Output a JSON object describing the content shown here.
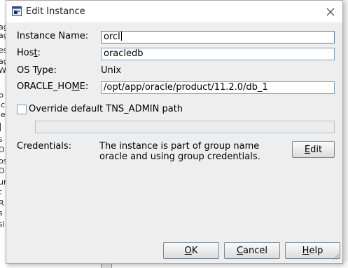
{
  "window": {
    "title": "Edit Instance",
    "icon": "app-window-icon"
  },
  "background_strip": {
    "fragments": [
      "ag",
      "ag",
      "es",
      "ag",
      "W",
      "p",
      "ic",
      "le",
      "l",
      "s",
      "D",
      "os",
      "D",
      "ur",
      "t",
      "R",
      "s",
      "si"
    ]
  },
  "form": {
    "instance_name": {
      "label_pre": "Instance Name:",
      "value": "orcl"
    },
    "host": {
      "label_pre": "Hos",
      "label_mn": "t",
      "label_post": ":",
      "value": "oracledb"
    },
    "os_type": {
      "label": "OS Type:",
      "value": "Unix"
    },
    "oracle_home": {
      "label_pre": "ORACLE_HO",
      "label_mn": "M",
      "label_post": "E:",
      "value": "/opt/app/oracle/product/11.2.0/db_1"
    },
    "override_tns": {
      "label": "Override default TNS_ADMIN path",
      "checked": false,
      "path_value": ""
    },
    "credentials": {
      "label": "Credentials:",
      "line1": "The instance is part of group name",
      "line2": "oracle and using group credentials.",
      "edit_button": {
        "mn": "E",
        "rest": "dit"
      }
    }
  },
  "buttons": {
    "ok": {
      "mn": "O",
      "rest": "K"
    },
    "cancel": {
      "mn": "C",
      "rest": "ancel"
    },
    "help": {
      "mn": "H",
      "rest": "elp"
    }
  },
  "colors": {
    "field_border": "#7f9db9",
    "dialog_bg": "#eeeeee",
    "titlebar_bg": "#ffffff"
  }
}
